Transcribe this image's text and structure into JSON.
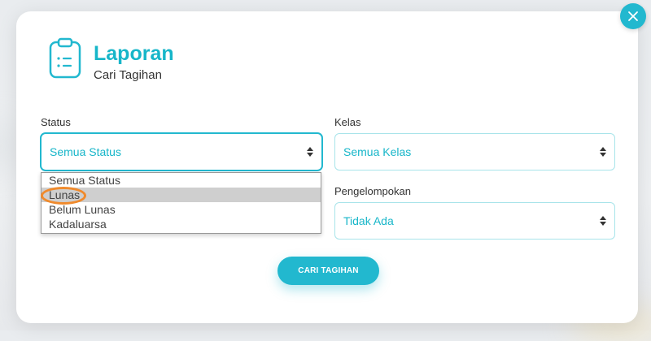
{
  "header": {
    "title": "Laporan",
    "subtitle": "Cari Tagihan",
    "icon": "clipboard-list-icon"
  },
  "close_icon": "close-icon",
  "form": {
    "status": {
      "label": "Status",
      "value": "Semua Status",
      "options": [
        "Semua Status",
        "Lunas",
        "Belum Lunas",
        "Kadaluarsa"
      ],
      "highlighted_option": "Lunas",
      "expanded": true
    },
    "kelas": {
      "label": "Kelas",
      "value": "Semua Kelas"
    },
    "pengelompokan": {
      "label": "Pengelompokan",
      "value": "Tidak Ada"
    }
  },
  "search_button": {
    "label": "CARI TAGIHAN"
  },
  "colors": {
    "accent": "#22b8cf",
    "title": "#17b6c9",
    "field_border": "#a8e4ea",
    "annotation_ring": "#f08a2c"
  }
}
